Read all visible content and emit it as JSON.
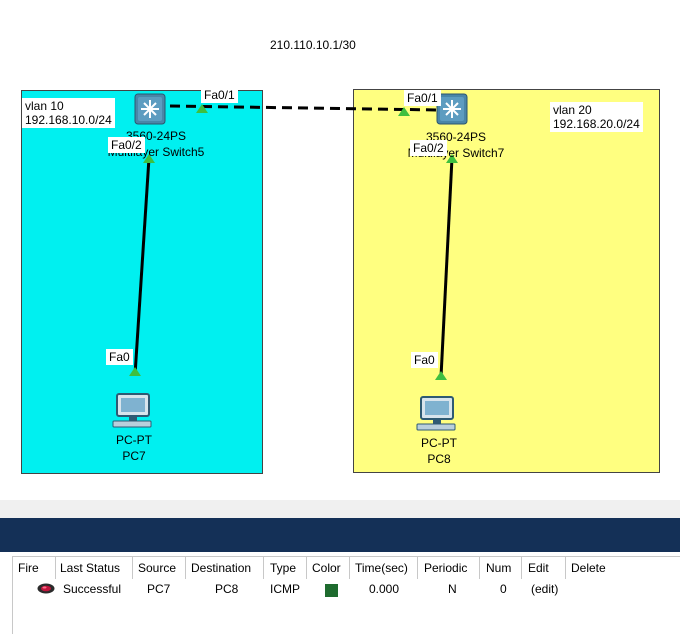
{
  "topology": {
    "link_ip": "210.110.10.1/30",
    "areas": [
      {
        "vlan": "vlan 10",
        "network": "192.168.10.0/24"
      },
      {
        "vlan": "vlan 20",
        "network": "192.168.20.0/24"
      }
    ],
    "switches": [
      {
        "model_line": "3560-24PS",
        "name_line": "Multilayer Switch5",
        "ports": [
          "Fa0/1",
          "Fa0/2"
        ]
      },
      {
        "model_line": "3560-24PS",
        "name_line": "Multilayer Switch7",
        "ports": [
          "Fa0/1",
          "Fa0/2"
        ]
      }
    ],
    "pcs": [
      {
        "type": "PC-PT",
        "name": "PC7",
        "port": "Fa0"
      },
      {
        "type": "PC-PT",
        "name": "PC8",
        "port": "Fa0"
      }
    ]
  },
  "pdu_table": {
    "headers": [
      "Fire",
      "Last Status",
      "Source",
      "Destination",
      "Type",
      "Color",
      "Time(sec)",
      "Periodic",
      "Num",
      "Edit",
      "Delete"
    ],
    "rows": [
      {
        "last_status": "Successful",
        "source": "PC7",
        "destination": "PC8",
        "type": "ICMP",
        "color": "#1e6b2e",
        "time": "0.000",
        "periodic": "N",
        "num": "0",
        "edit": "(edit)"
      }
    ]
  },
  "colors": {
    "vlan10_area": "#00f0f0",
    "vlan20_area": "#ffff80",
    "link_up": "#3fbf3f",
    "header_bar": "#143057"
  }
}
